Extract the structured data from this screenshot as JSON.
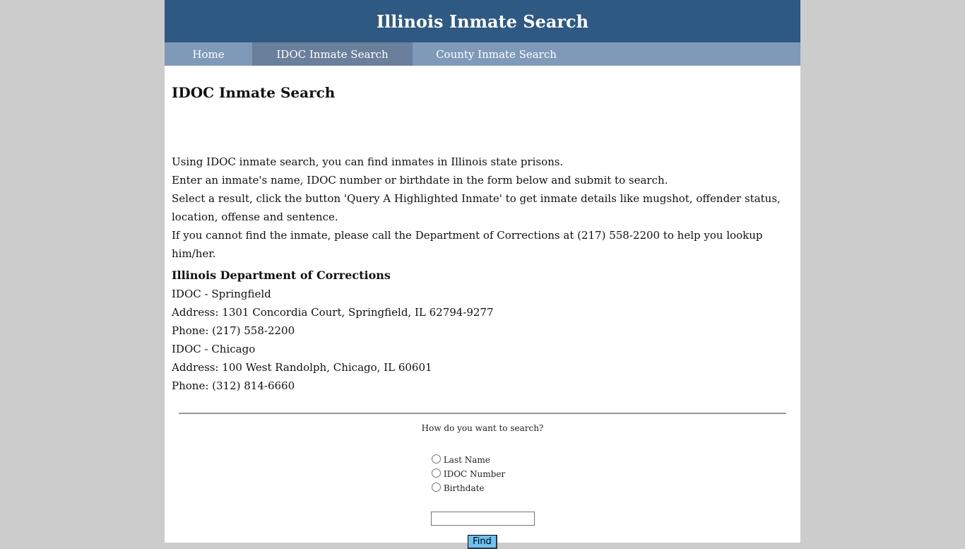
{
  "header": {
    "title": "Illinois Inmate Search"
  },
  "nav": {
    "items": [
      {
        "label": "Home"
      },
      {
        "label": "IDOC Inmate Search"
      },
      {
        "label": "County Inmate Search"
      }
    ],
    "active_index": 1
  },
  "main": {
    "title": "IDOC Inmate Search",
    "intro": [
      "Using IDOC inmate search, you can find inmates in Illinois state prisons.",
      "Enter an inmate's name, IDOC number or birthdate in the form below and submit to search.",
      "Select a result, click the button 'Query A Highlighted Inmate' to get inmate details like mugshot, offender status, location, offense and sentence.",
      "If you cannot find the inmate, please call the Department of Corrections at (217) 558-2200 to help you lookup him/her."
    ],
    "department": {
      "title": "Illinois Department of Corrections",
      "lines": [
        "IDOC - Springfield",
        "Address: 1301 Concordia Court, Springfield, IL 62794-9277",
        "Phone: (217) 558-2200",
        "IDOC - Chicago",
        "Address: 100 West Randolph, Chicago, IL 60601",
        "Phone: (312) 814-6660"
      ]
    }
  },
  "search_form": {
    "question": "How do you want to search?",
    "options": [
      {
        "label": "Last Name"
      },
      {
        "label": "IDOC Number"
      },
      {
        "label": "Birthdate"
      }
    ],
    "input_value": "",
    "find_label": "Find"
  },
  "colors": {
    "background": "#cccccc",
    "header": "#2e5982",
    "nav": "#7f9ab9",
    "nav_active": "#6a7f9b",
    "find_button": "#6cc1f2"
  }
}
